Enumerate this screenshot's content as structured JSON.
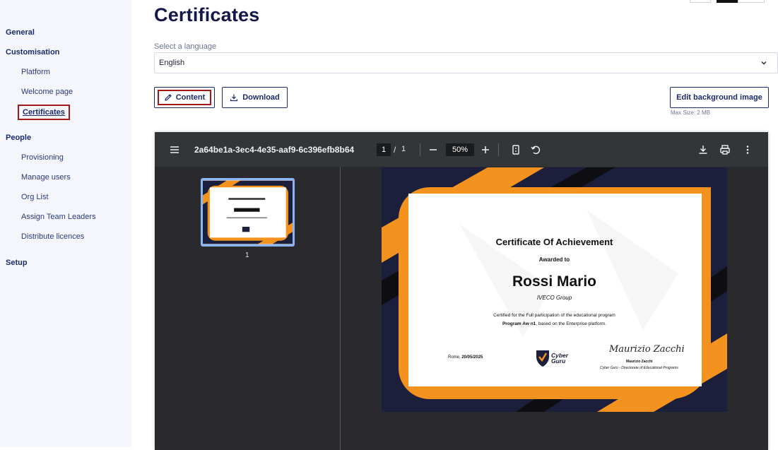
{
  "sidebar": {
    "general": "General",
    "customisation": "Customisation",
    "customisation_items": [
      "Platform",
      "Welcome page",
      "Certificates"
    ],
    "people": "People",
    "people_items": [
      "Provisioning",
      "Manage users",
      "Org List",
      "Assign Team Leaders",
      "Distribute licences"
    ],
    "setup": "Setup"
  },
  "page": {
    "title": "Certificates",
    "language_label": "Select a language",
    "language_value": "English",
    "content_button": "Content",
    "download_button": "Download",
    "edit_bg_button": "Edit background image",
    "max_size": "Max Size: 2 MB"
  },
  "viewer": {
    "doc_name": "2a64be1a-3ec4-4e35-aaf9-6c396efb8b64",
    "current_page": "1",
    "page_separator": "/",
    "total_pages": "1",
    "zoom": "50%",
    "thumb_label": "1",
    "icons": [
      "menu-icon",
      "zoom-out-icon",
      "zoom-in-icon",
      "fit-page-icon",
      "rotate-icon",
      "download-icon",
      "print-icon",
      "more-vertical-icon"
    ]
  },
  "certificate": {
    "title": "Certificate Of Achievement",
    "awarded_to": "Awarded to",
    "name": "Rossi Mario",
    "company": "IVECO Group",
    "certified_line": "Certified for the Full participation of the educational program",
    "program": "Program Aw n1",
    "program_suffix": ", based on the Enterprise platform.",
    "place": "Rome, ",
    "date": "20/05/2025",
    "logo_text_1": "Cyber",
    "logo_text_2": "Guru",
    "signature_script": "Maurizio Zacchi",
    "signer_name": "Maurizio Zacchi",
    "signer_role": "Cyber Guru - Directorate of Educational Programs"
  },
  "colors": {
    "orange": "#f4921f",
    "navy": "#1c1f3b",
    "accent": "#1b2a6b",
    "highlight": "#a01818"
  }
}
